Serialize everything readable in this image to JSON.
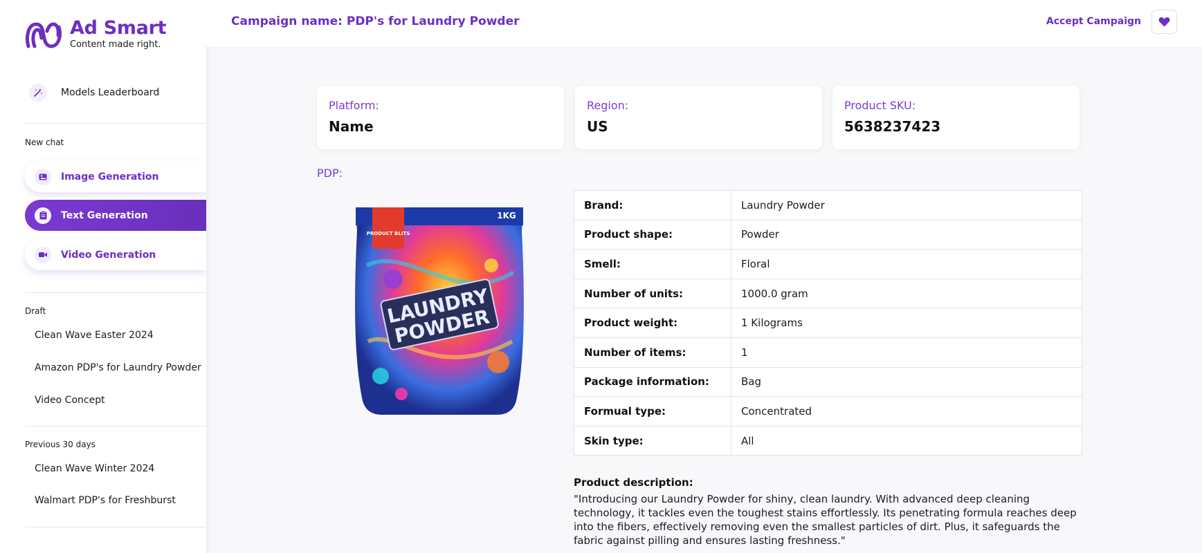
{
  "brand": {
    "name": "Ad Smart",
    "tagline": "Content made right."
  },
  "sidebar": {
    "leaderboard": "Models Leaderboard",
    "new_chat_label": "New chat",
    "generators": [
      {
        "label": "Image Generation",
        "active": false
      },
      {
        "label": "Text Generation",
        "active": true
      },
      {
        "label": "Video Generation",
        "active": false
      }
    ],
    "draft_label": "Draft",
    "drafts": [
      "Clean Wave Easter 2024",
      "Amazon PDP's for Laundry Powder",
      "Video Concept"
    ],
    "previous_label": "Previous 30 days",
    "previous": [
      "Clean Wave Winter 2024",
      "Walmart PDP's for Freshburst"
    ]
  },
  "header": {
    "campaign": "Campaign name: PDP's for Laundry Powder",
    "accept": "Accept Campaign"
  },
  "cards": [
    {
      "label": "Platform:",
      "value": "Name"
    },
    {
      "label": "Region:",
      "value": "US"
    },
    {
      "label": "Product SKU:",
      "value": "5638237423"
    }
  ],
  "pdp_label": "PDP:",
  "product_image": {
    "title_line1": "LAUNDRY",
    "title_line2": "POWDER",
    "weight_tag": "1KG",
    "badge": "PRODUCT BLITS"
  },
  "specs": [
    {
      "key": "Brand:",
      "value": "Laundry Powder"
    },
    {
      "key": "Product shape:",
      "value": "Powder"
    },
    {
      "key": "Smell:",
      "value": "Floral"
    },
    {
      "key": "Number of units:",
      "value": "1000.0 gram"
    },
    {
      "key": "Product weight:",
      "value": "1 Kilograms"
    },
    {
      "key": "Number of items:",
      "value": "1"
    },
    {
      "key": "Package information:",
      "value": "Bag"
    },
    {
      "key": "Formual type:",
      "value": "Concentrated"
    },
    {
      "key": "Skin type:",
      "value": "All"
    }
  ],
  "description": {
    "title": "Product description:",
    "text": "\"Introducing our Laundry Powder for shiny, clean laundry. With advanced deep cleaning technology, it tackles even the toughest stains effortlessly. Its penetrating formula reaches deep into the fibers, effectively removing even the smallest particles of dirt. Plus, it safeguards the fabric against pilling and ensures lasting freshness.\""
  },
  "colors": {
    "accent": "#6c2fc2",
    "active_bg": "#7a3ad3",
    "label": "#7a3dcc"
  }
}
